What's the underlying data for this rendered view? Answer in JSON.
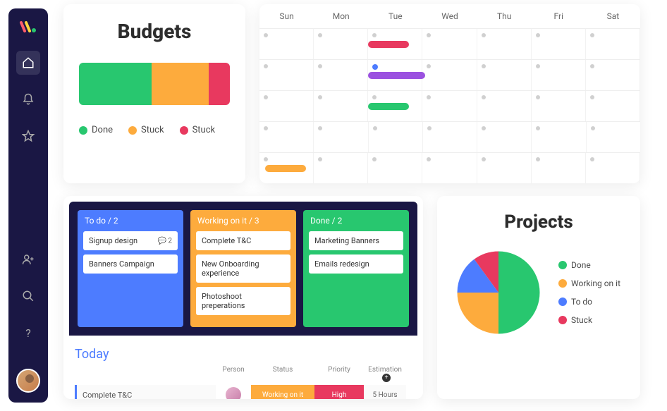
{
  "colors": {
    "green": "#28c76f",
    "orange": "#fdab3d",
    "red": "#e8395f",
    "blue": "#4d7cff",
    "purple": "#9b51e0"
  },
  "sidebar": {
    "items": [
      "home",
      "notifications",
      "favorites"
    ],
    "bottom_items": [
      "invite",
      "search",
      "help"
    ]
  },
  "budgets": {
    "title": "Budgets",
    "segments": [
      {
        "label": "Done",
        "color": "#28c76f",
        "pct": 48
      },
      {
        "label": "Stuck",
        "color": "#fdab3d",
        "pct": 38
      },
      {
        "label": "Stuck",
        "color": "#e8395f",
        "pct": 14
      }
    ]
  },
  "calendar": {
    "days": [
      "Sun",
      "Mon",
      "Tue",
      "Wed",
      "Thu",
      "Fri",
      "Sat"
    ],
    "events": [
      {
        "row": 0,
        "start": 2,
        "span": 1,
        "color": "#e8395f"
      },
      {
        "row": 1,
        "start": 2,
        "span": 1.4,
        "color": "#9b51e0"
      },
      {
        "row": 2,
        "start": 2,
        "span": 1,
        "color": "#28c76f"
      },
      {
        "row": 4,
        "start": 0.1,
        "span": 1,
        "color": "#fdab3d"
      }
    ],
    "blue_dot": {
      "row": 1,
      "col": 2
    }
  },
  "kanban": {
    "columns": [
      {
        "title": "To do / 2",
        "color": "#4d7cff",
        "items": [
          {
            "text": "Signup design",
            "comments": 2
          },
          {
            "text": "Banners Campaign"
          }
        ]
      },
      {
        "title": "Working on it / 3",
        "color": "#fdab3d",
        "items": [
          {
            "text": "Complete T&C"
          },
          {
            "text": "New Onboarding experience"
          },
          {
            "text": "Photoshoot preperations"
          }
        ]
      },
      {
        "title": "Done / 2",
        "color": "#28c76f",
        "items": [
          {
            "text": "Marketing Banners"
          },
          {
            "text": "Emails redesign"
          }
        ]
      }
    ]
  },
  "today": {
    "title": "Today",
    "headers": {
      "person": "Person",
      "status": "Status",
      "priority": "Priority",
      "estimation": "Estimation"
    },
    "task": "Complete T&C",
    "status": "Working on it",
    "priority": "High",
    "estimation": "5 Hours"
  },
  "projects": {
    "title": "Projects",
    "legend": [
      {
        "label": "Done",
        "color": "#28c76f"
      },
      {
        "label": "Working on it",
        "color": "#fdab3d"
      },
      {
        "label": "To do",
        "color": "#4d7cff"
      },
      {
        "label": "Stuck",
        "color": "#e8395f"
      }
    ]
  },
  "chart_data": [
    {
      "type": "bar",
      "title": "Budgets",
      "categories": [
        "Done",
        "Stuck",
        "Stuck"
      ],
      "values": [
        48,
        38,
        14
      ],
      "colors": [
        "#28c76f",
        "#fdab3d",
        "#e8395f"
      ],
      "orientation": "stacked-horizontal"
    },
    {
      "type": "pie",
      "title": "Projects",
      "series": [
        {
          "name": "Done",
          "value": 50,
          "color": "#28c76f"
        },
        {
          "name": "Working on it",
          "value": 25,
          "color": "#fdab3d"
        },
        {
          "name": "To do",
          "value": 15,
          "color": "#4d7cff"
        },
        {
          "name": "Stuck",
          "value": 10,
          "color": "#e8395f"
        }
      ]
    }
  ]
}
